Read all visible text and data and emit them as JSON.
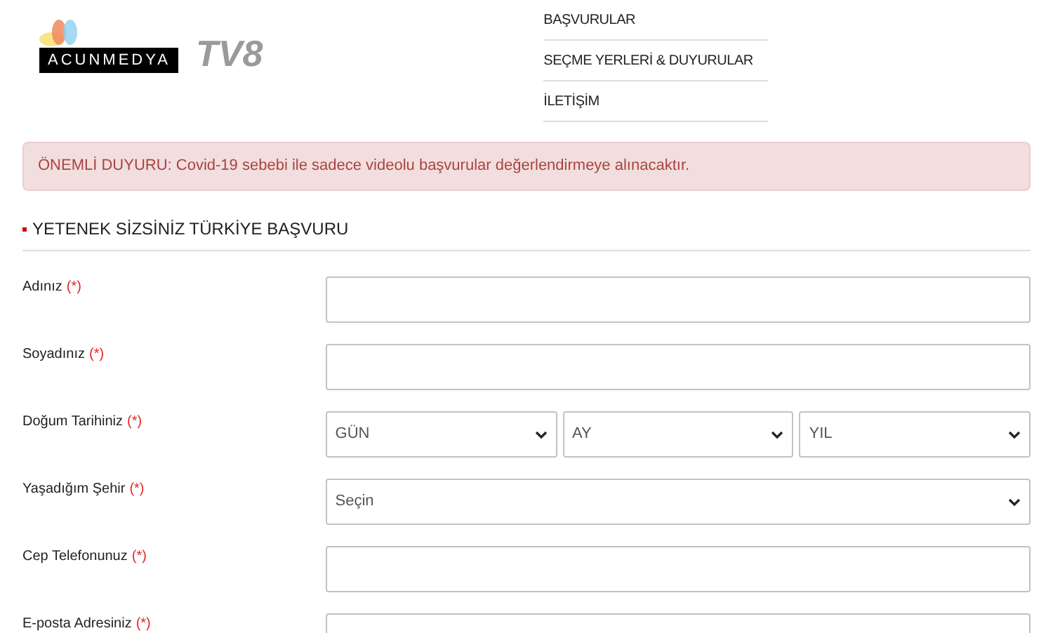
{
  "logos": {
    "acunmedya": "ACUNMEDYA",
    "tv8": "TV8"
  },
  "nav": [
    "BAŞVURULAR",
    "SEÇME YERLERİ & DUYURULAR",
    "İLETİŞİM"
  ],
  "alert": "ÖNEMLİ DUYURU: Covid-19 sebebi ile sadece videolu başvurular değerlendirmeye alınacaktır.",
  "section_title": "YETENEK SİZSİNİZ TÜRKİYE BAŞVURU",
  "fields": [
    {
      "kind": "text",
      "label": "Adınız",
      "required": "(*)"
    },
    {
      "kind": "text",
      "label": "Soyadınız",
      "required": "(*)"
    },
    {
      "kind": "date",
      "label": "Doğum Tarihiniz",
      "required": "(*)",
      "options": [
        "GÜN",
        "AY",
        "YIL"
      ]
    },
    {
      "kind": "select",
      "label": "Yaşadığım Şehir",
      "required": "(*)",
      "options": [
        "Seçin"
      ]
    },
    {
      "kind": "text",
      "label": "Cep Telefonunuz",
      "required": "(*)"
    },
    {
      "kind": "text",
      "label": "E-posta Adresiniz",
      "required": "(*)"
    }
  ]
}
